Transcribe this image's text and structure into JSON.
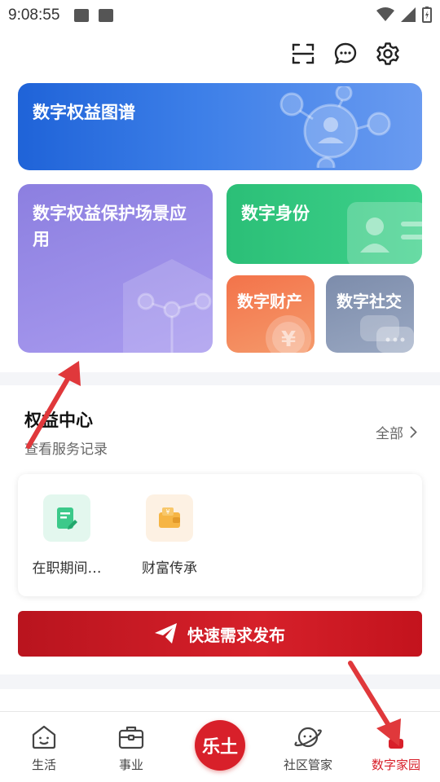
{
  "status_bar": {
    "time": "9:08:55"
  },
  "top_actions": {
    "icons": [
      "scan-icon",
      "message-icon",
      "settings-icon"
    ]
  },
  "cards": {
    "atlas": "数字权益图谱",
    "scene": "数字权益保护场景应用",
    "identity": "数字身份",
    "asset": "数字财产",
    "social": "数字社交"
  },
  "rights_center": {
    "title": "权益中心",
    "subtitle": "查看服务记录",
    "view_all": "全部",
    "services": [
      {
        "label": "在职期间…",
        "icon": "document-edit-icon"
      },
      {
        "label": "财富传承",
        "icon": "wallet-icon"
      }
    ]
  },
  "publish": {
    "label": "快速需求发布"
  },
  "bottom_nav": {
    "items": [
      {
        "label": "生活",
        "icon": "smile-home-icon"
      },
      {
        "label": "事业",
        "icon": "briefcase-icon"
      },
      {
        "label": "乐土",
        "icon": "center-logo"
      },
      {
        "label": "社区管家",
        "icon": "planet-icon"
      },
      {
        "label": "数字家园",
        "icon": "digital-home-icon"
      }
    ],
    "active_index": 4
  },
  "colors": {
    "accent": "#d8202a",
    "atlas_blue": "#2f74e0",
    "identity_green": "#2bbf77",
    "scene_purple": "#9a8ce8",
    "asset_orange": "#f47b4f",
    "social_gray": "#8896b3"
  }
}
